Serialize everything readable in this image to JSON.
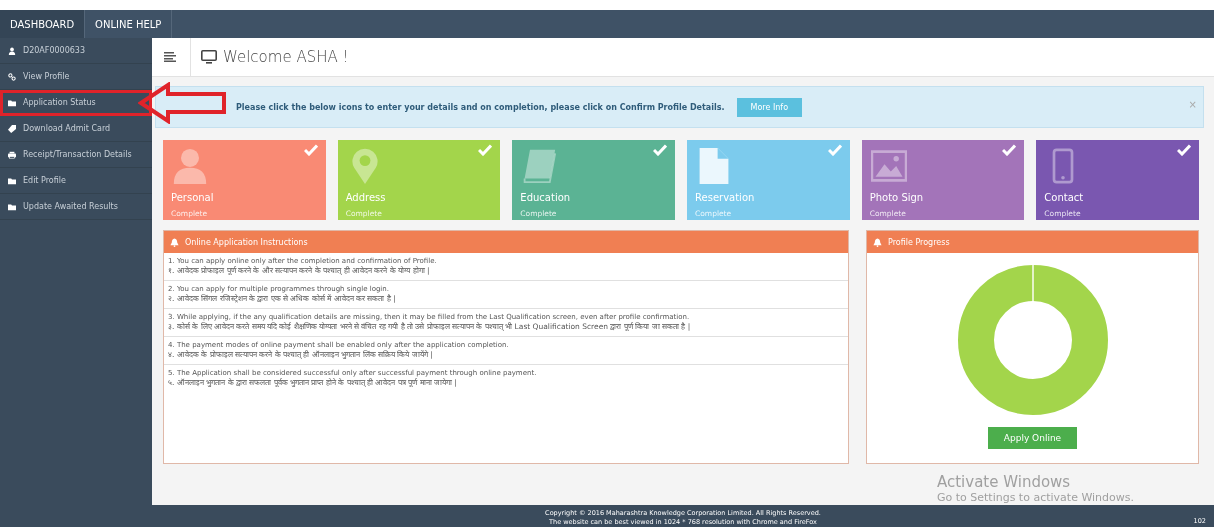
{
  "top_nav": [
    {
      "label": "DASHBOARD",
      "selected": true
    },
    {
      "label": "ONLINE HELP",
      "selected": false
    }
  ],
  "sidebar": {
    "items": [
      {
        "label": "D20AF0000633",
        "kind": "user",
        "selected": false,
        "annotated": false
      },
      {
        "label": "View Profile",
        "kind": "link",
        "selected": false,
        "annotated": false
      },
      {
        "label": "Application Status",
        "kind": "folder",
        "selected": false,
        "annotated": true
      },
      {
        "label": "Download Admit Card",
        "kind": "tag",
        "selected": false,
        "annotated": false
      },
      {
        "label": "Receipt/Transaction Details",
        "kind": "print",
        "selected": false,
        "annotated": false
      },
      {
        "label": "Edit Profile",
        "kind": "folder",
        "selected": false,
        "annotated": false
      },
      {
        "label": "Update Awaited Results",
        "kind": "folder",
        "selected": false,
        "annotated": false
      }
    ]
  },
  "header": {
    "title": "Welcome ASHA !"
  },
  "alert": {
    "text": "Please click the below icons to enter your details and on completion, please click on Confirm Profile Details.",
    "button": "More Info",
    "close": "×"
  },
  "tiles": [
    {
      "kind": "person",
      "title": "Personal",
      "status": "Complete",
      "checked": true,
      "color": "#f98a74"
    },
    {
      "kind": "pin",
      "title": "Address",
      "status": "Complete",
      "checked": true,
      "color": "#a3d54b"
    },
    {
      "kind": "book",
      "title": "Education",
      "status": "Complete",
      "checked": true,
      "color": "#5bb394"
    },
    {
      "kind": "file",
      "title": "Reservation",
      "status": "Complete",
      "checked": true,
      "color": "#7ccbed"
    },
    {
      "kind": "image",
      "title": "Photo Sign",
      "status": "Complete",
      "checked": true,
      "color": "#a374b9"
    },
    {
      "kind": "phone",
      "title": "Contact",
      "status": "Complete",
      "checked": true,
      "color": "#7a57b0"
    }
  ],
  "instructions": {
    "title": "Online Application Instructions",
    "items": [
      {
        "en": "1. You can apply online only after the completion and confirmation of Profile.",
        "hi": "१. आवेदक प्रोफाइल पूर्ण करने के और सत्यापन करने के पश्चात् ही आवेदन करने के योग्य होगा |"
      },
      {
        "en": "2. You can apply for multiple programmes through single login.",
        "hi": "२. आवेदक सिंगल रजिस्ट्रेशन के द्वारा एक से अधिक कोर्स में आवेदन कर सकता है |"
      },
      {
        "en": "3. While applying, if the any qualification details are missing, then it may be filled from the Last Qualification screen, even after profile confirmation.",
        "hi": "३. कोर्स के लिए आवेदन करते समय यदि कोई शैक्षणिक योग्यता भरने से वंचित रह गयी है तो उसे प्रोफाइल सत्यापन के पश्चात् भी Last Qualification Screen द्वारा पूर्ण किया जा सकता है |"
      },
      {
        "en": "4. The payment modes of online payment shall be enabled only after the application completion.",
        "hi": "४. आवेदक के प्रोफाइल सत्यापन करने के पश्चात् ही ऑनलाइन भुगतान लिंक सक्रिय किये जायेंगे |"
      },
      {
        "en": "5. The Application shall be considered successful only after successful payment through online payment.",
        "hi": "५. ऑनलाइन भुगतान के द्वारा सफलता पूर्वक भुगतान प्राप्त होने के पश्चात् ही आवेदन पत्र पूर्ण माना जायेगा |"
      }
    ]
  },
  "progress": {
    "title": "Profile Progress",
    "button": "Apply Online"
  },
  "footer": {
    "copyright": "Copyright © 2016 Maharashtra Knowledge Corporation Limited. All Rights Reserved.",
    "note": "The website can be best viewed in 1024 * 768 resolution with Chrome and FireFox",
    "page": "102"
  },
  "os_notice": {
    "title": "Activate Windows",
    "text": "Go to Settings to activate Windows."
  }
}
